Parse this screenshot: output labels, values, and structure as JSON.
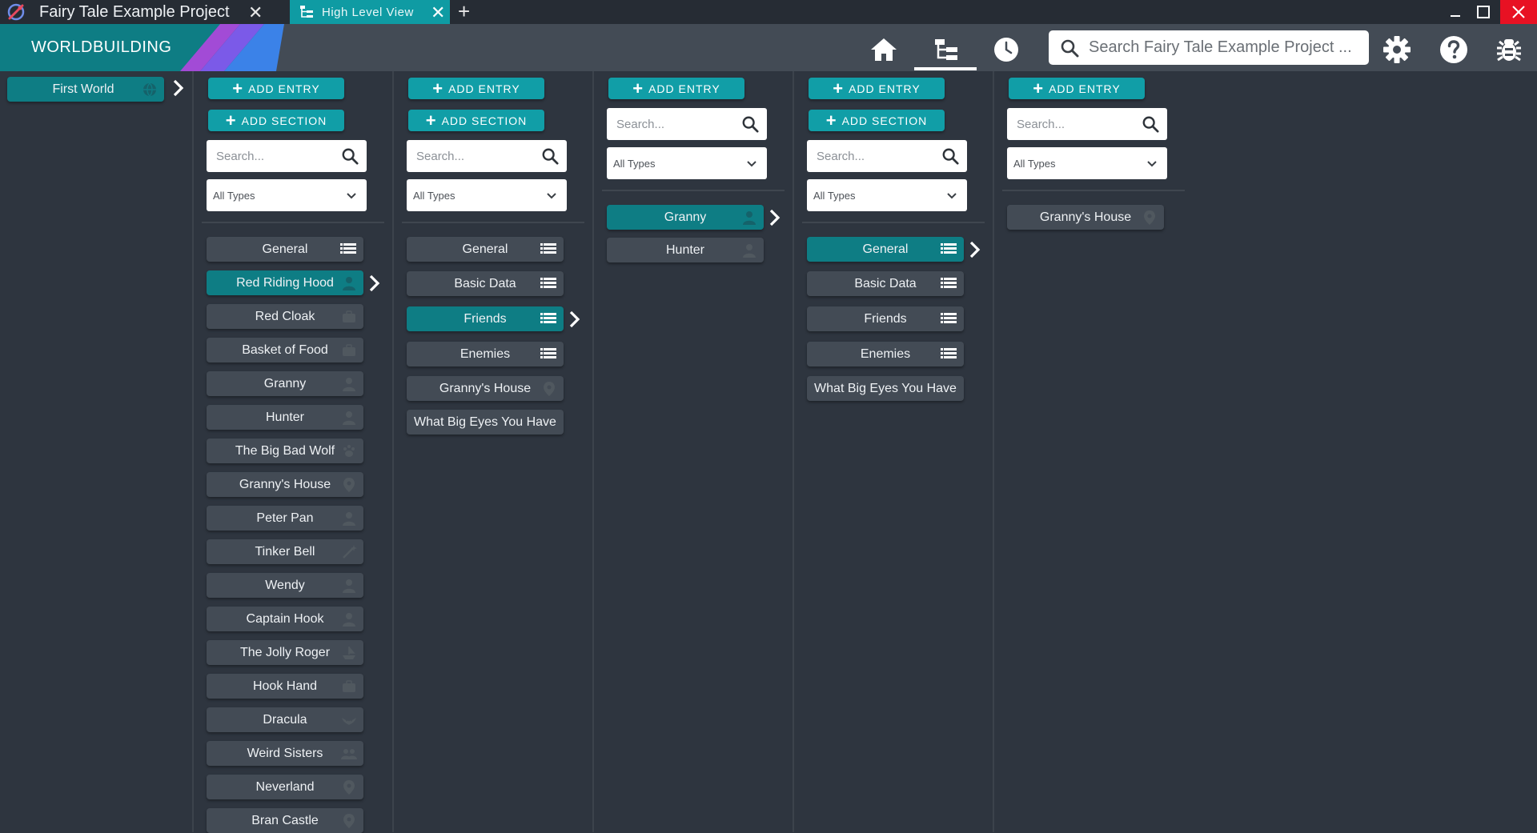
{
  "titlebar": {
    "project_tab": "Fairy Tale Example Project",
    "active_tab": "High Level View",
    "new_tab_symbol": "+",
    "close_symbol": "✕"
  },
  "header": {
    "section_label": "WORLDBUILDING",
    "search_placeholder": "Search Fairy Tale Example Project ...",
    "accent_color": "#119ea7",
    "selected_color": "#0e7d84"
  },
  "controls": {
    "add_entry": "ADD ENTRY",
    "add_section": "ADD SECTION",
    "search_placeholder": "Search...",
    "type_filter": "All Types"
  },
  "col0": {
    "items": [
      {
        "label": "First World",
        "icon": "globe-icon"
      }
    ]
  },
  "col1": {
    "items": [
      {
        "label": "General",
        "icon": "list-icon"
      },
      {
        "label": "Red Riding Hood",
        "icon": "person-icon",
        "selected": true
      },
      {
        "label": "Red Cloak",
        "icon": "box-icon"
      },
      {
        "label": "Basket of Food",
        "icon": "box-icon"
      },
      {
        "label": "Granny",
        "icon": "person-icon"
      },
      {
        "label": "Hunter",
        "icon": "person-icon"
      },
      {
        "label": "The Big Bad Wolf",
        "icon": "paw-icon"
      },
      {
        "label": "Granny's House",
        "icon": "location-pin-icon"
      },
      {
        "label": "Peter Pan",
        "icon": "person-icon"
      },
      {
        "label": "Tinker Bell",
        "icon": "wand-icon"
      },
      {
        "label": "Wendy",
        "icon": "person-icon"
      },
      {
        "label": "Captain Hook",
        "icon": "person-icon"
      },
      {
        "label": "The Jolly Roger",
        "icon": "ship-icon"
      },
      {
        "label": "Hook Hand",
        "icon": "box-icon"
      },
      {
        "label": "Dracula",
        "icon": "bat-icon"
      },
      {
        "label": "Weird Sisters",
        "icon": "group-icon"
      },
      {
        "label": "Neverland",
        "icon": "location-pin-icon"
      },
      {
        "label": "Bran Castle",
        "icon": "location-pin-icon"
      }
    ]
  },
  "col2": {
    "items": [
      {
        "label": "General",
        "icon": "list-icon"
      },
      {
        "label": "Basic Data",
        "icon": "list-icon"
      },
      {
        "label": "Friends",
        "icon": "list-icon",
        "selected": true
      },
      {
        "label": "Enemies",
        "icon": "list-icon"
      },
      {
        "label": "Granny's House",
        "icon": "location-pin-icon"
      },
      {
        "label": "What Big Eyes You Have",
        "icon": ""
      }
    ]
  },
  "col3": {
    "items": [
      {
        "label": "Granny",
        "icon": "person-icon",
        "selected": true
      },
      {
        "label": "Hunter",
        "icon": "person-icon"
      }
    ]
  },
  "col4": {
    "items": [
      {
        "label": "General",
        "icon": "list-icon",
        "selected": true
      },
      {
        "label": "Basic Data",
        "icon": "list-icon"
      },
      {
        "label": "Friends",
        "icon": "list-icon"
      },
      {
        "label": "Enemies",
        "icon": "list-icon"
      },
      {
        "label": "What Big Eyes You Have",
        "icon": ""
      }
    ]
  },
  "col5": {
    "items": [
      {
        "label": "Granny's House",
        "icon": "location-pin-icon"
      }
    ]
  }
}
